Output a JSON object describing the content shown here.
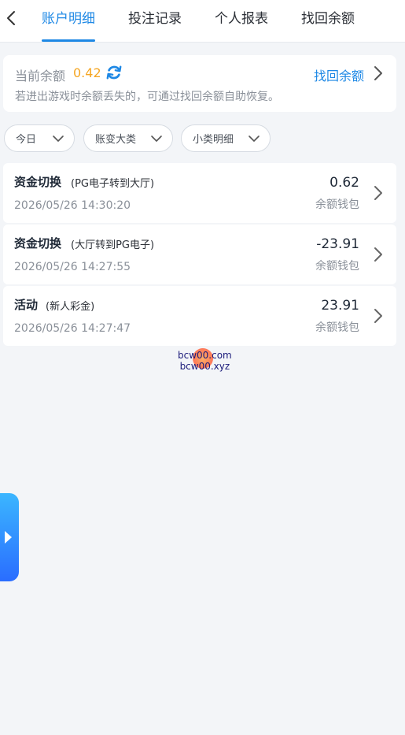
{
  "tabs": [
    {
      "label": "账户明细",
      "active": true
    },
    {
      "label": "投注记录",
      "active": false
    },
    {
      "label": "个人报表",
      "active": false
    },
    {
      "label": "找回余额",
      "active": false
    }
  ],
  "balance": {
    "label": "当前余额",
    "value": "0.42",
    "recover_label": "找回余额",
    "hint": "若进出游戏时余额丢失的，可通过找回余额自助恢复。"
  },
  "filters": [
    {
      "label": "今日"
    },
    {
      "label": "账变大类"
    },
    {
      "label": "小类明细"
    }
  ],
  "records": [
    {
      "title": "资金切换",
      "note": "(PG电子转到大厅)",
      "time": "2026/05/26 14:30:20",
      "amount": "0.62",
      "wallet": "余额钱包"
    },
    {
      "title": "资金切换",
      "note": "(大厅转到PG电子)",
      "time": "2026/05/26 14:27:55",
      "amount": "-23.91",
      "wallet": "余额钱包"
    },
    {
      "title": "活动",
      "note": "(新人彩金)",
      "time": "2026/05/26 14:27:47",
      "amount": "23.91",
      "wallet": "余额钱包"
    }
  ],
  "watermark": {
    "line1": "bcw00.com",
    "line2": "bcw00.xyz"
  },
  "colors": {
    "accent": "#1e88e5",
    "balance": "#f5a623"
  }
}
